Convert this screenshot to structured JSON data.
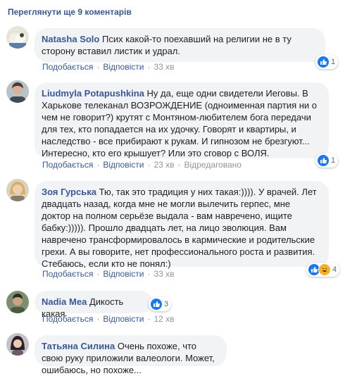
{
  "view_more": "Переглянути ще 9 коментарів",
  "labels": {
    "like": "Подобається",
    "reply": "Відповісти",
    "edited": "Відредаговано"
  },
  "comments": [
    {
      "author": "Natasha Solo",
      "text": "Псих какой-то поехавший на религии не в ту сторону вставил листик и удрал.",
      "reactions": {
        "icons": [
          "like-icon"
        ],
        "count": "1"
      },
      "time": "33 хв"
    },
    {
      "author": "Liudmyla Potapushkina",
      "text": "Ну да, еще одни свидетели Иеговы. В Харькове телеканал ВОЗРОЖДЕНИЕ (одноименная партия ни о чем не говорит?) крутят с Монтяном-любителем бога передачи для тех, кто попадается на их удочку. Говорят и квартиры, и наследство - все прибирают к рукам. И гипнозом не брезгуют... Интересно, кто его крышует? Или это сговор с ВОЛЯ.",
      "reactions": {
        "icons": [
          "like-icon"
        ],
        "count": "1"
      },
      "time": "23 хв",
      "edited": true
    },
    {
      "author": "Зоя Гурська",
      "text": "Тю, так это традиция у них такая:)))). У врачей. Лет двадцать назад, когда мне не могли вылечить герпес, мне доктор на полном серьёзе выдала - вам навречено, ищите бабку:))))). Прошло двадцать лет, на лицо эволюция. Вам навречено трансформировалось в кармические и родительские грехи. А вы говорите, нет профессионального роста и развития. Стебаюсь, если кто не понял:)",
      "reactions": {
        "icons": [
          "like-icon",
          "haha-icon"
        ],
        "count": "4"
      },
      "time": "33 хв"
    },
    {
      "author": "Nadia Mea",
      "text": "Дикость какая",
      "reactions": {
        "icons": [
          "like-icon"
        ],
        "count": "3"
      },
      "time": "12 хв"
    },
    {
      "author": "Татьяна Силина",
      "text": "Очень похоже, что свою руку приложили валеологи. Может, ошибаюсь, но похоже...",
      "reactions": null,
      "time": ""
    }
  ],
  "colors": {
    "link": "#385898",
    "bubble": "#f2f3f5",
    "meta": "#90949c",
    "like": "#1877f2",
    "haha": "#f7b125"
  }
}
